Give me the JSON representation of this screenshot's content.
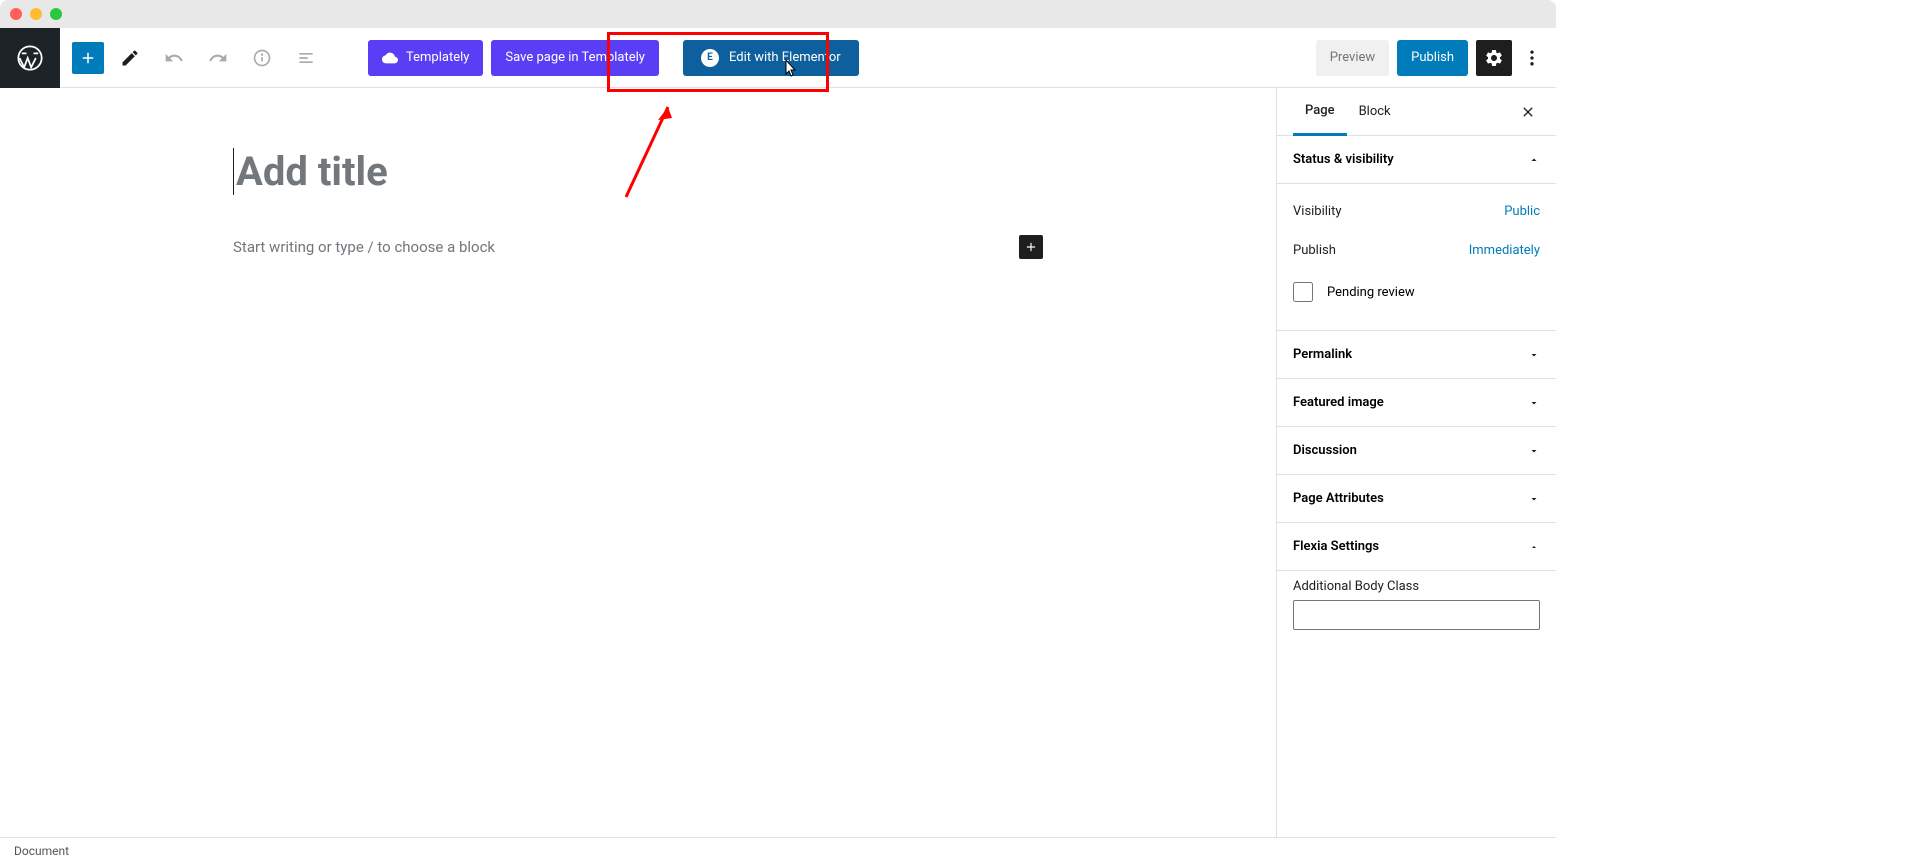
{
  "toolbar": {
    "templately_label": "Templately",
    "save_templately_label": "Save page in Templately",
    "elementor_label": "Edit with Elementor",
    "preview_label": "Preview",
    "publish_label": "Publish"
  },
  "editor": {
    "title_placeholder": "Add title",
    "block_placeholder": "Start writing or type / to choose a block"
  },
  "sidebar": {
    "tab_page": "Page",
    "tab_block": "Block",
    "panels": {
      "status_visibility": "Status & visibility",
      "permalink": "Permalink",
      "featured_image": "Featured image",
      "discussion": "Discussion",
      "page_attributes": "Page Attributes",
      "flexia_settings": "Flexia Settings"
    },
    "visibility_label": "Visibility",
    "visibility_value": "Public",
    "publish_label": "Publish",
    "publish_value": "Immediately",
    "pending_review": "Pending review",
    "body_class_label": "Additional Body Class"
  },
  "bottom": {
    "breadcrumb": "Document"
  }
}
